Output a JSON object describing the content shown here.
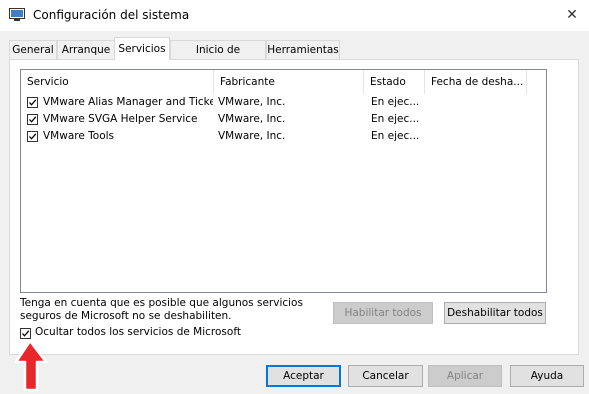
{
  "window": {
    "title": "Configuración del sistema",
    "close_glyph": "✕"
  },
  "tabs": [
    {
      "label": "General"
    },
    {
      "label": "Arranque"
    },
    {
      "label": "Servicios",
      "active": true
    },
    {
      "label": "Inicio de Windows"
    },
    {
      "label": "Herramientas"
    }
  ],
  "services": {
    "columns": [
      "Servicio",
      "Fabricante",
      "Estado",
      "Fecha de desha..."
    ],
    "rows": [
      {
        "checked": true,
        "name": "VMware Alias Manager and Ticke...",
        "vendor": "VMware, Inc.",
        "status": "En ejec..."
      },
      {
        "checked": true,
        "name": "VMware SVGA Helper Service",
        "vendor": "VMware, Inc.",
        "status": "En ejec..."
      },
      {
        "checked": true,
        "name": "VMware Tools",
        "vendor": "VMware, Inc.",
        "status": "En ejec..."
      }
    ]
  },
  "note": "Tenga en cuenta que es posible que algunos servicios seguros de Microsoft no se deshabiliten.",
  "buttons": {
    "enable_all": "Habilitar todos",
    "disable_all": "Deshabilitar todos",
    "ok": "Aceptar",
    "cancel": "Cancelar",
    "apply": "Aplicar",
    "help": "Ayuda"
  },
  "hide_microsoft": {
    "label": "Ocultar todos los servicios de Microsoft",
    "checked": true
  },
  "colors": {
    "accent": "#0078d7",
    "arrow": "#e8272a"
  }
}
